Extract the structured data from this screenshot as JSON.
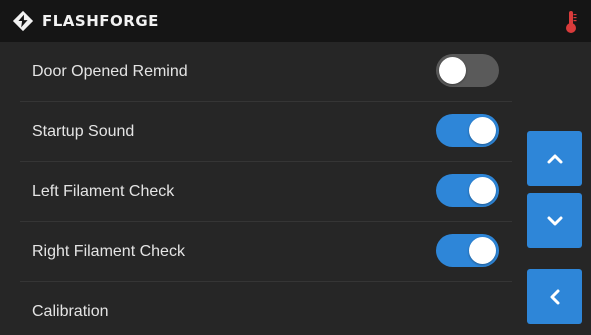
{
  "header": {
    "brand": "FLASHFORGE",
    "logo_icon": "flashforge-logo-icon",
    "status_icon": "thermometer-icon"
  },
  "settings": {
    "items": [
      {
        "label": "Door Opened Remind",
        "control": "toggle",
        "on": false
      },
      {
        "label": "Startup Sound",
        "control": "toggle",
        "on": true
      },
      {
        "label": "Left Filament Check",
        "control": "toggle",
        "on": true
      },
      {
        "label": "Right Filament Check",
        "control": "toggle",
        "on": true
      },
      {
        "label": "Calibration",
        "control": "none"
      }
    ]
  },
  "nav": {
    "up_icon": "chevron-up-icon",
    "down_icon": "chevron-down-icon",
    "back_icon": "chevron-left-icon"
  },
  "colors": {
    "accent": "#2e86d8",
    "toggle_off": "#5a5a5a",
    "background": "#262626",
    "topbar": "#151515",
    "thermometer": "#d93b3b"
  }
}
